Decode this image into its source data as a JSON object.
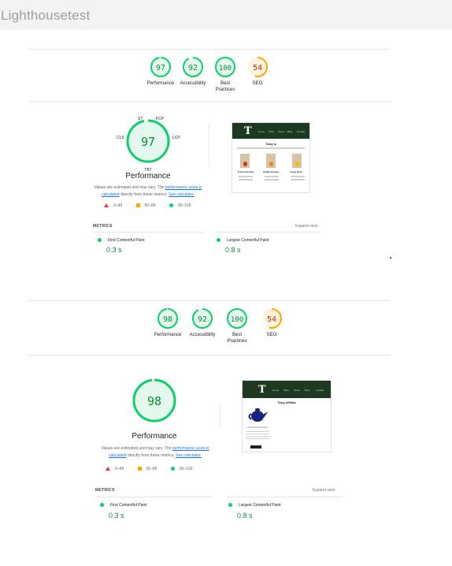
{
  "header": {
    "title": "Lighthousetest"
  },
  "report1": {
    "gauges": [
      {
        "score": "97",
        "label1": "Performance",
        "label2": "",
        "fraction": 0.97,
        "color": "#0cce6b",
        "bg": "#e5f8ee",
        "text": "#0c8a3a"
      },
      {
        "score": "92",
        "label1": "Accessibility",
        "label2": "",
        "fraction": 0.92,
        "color": "#0cce6b",
        "bg": "#e5f8ee",
        "text": "#0c8a3a"
      },
      {
        "score": "100",
        "label1": "Best",
        "label2": "Practices",
        "fraction": 1.0,
        "color": "#0cce6b",
        "bg": "#e5f8ee",
        "text": "#0c8a3a"
      },
      {
        "score": "54",
        "label1": "SEO",
        "label2": "",
        "fraction": 0.54,
        "color": "#ffa400",
        "bg": "#fff3e0",
        "text": "#c33300"
      }
    ],
    "big_score": "97",
    "big_label": "Performance",
    "metric_labels": {
      "st": "ST",
      "fcp": "FCP",
      "cls": "CLS",
      "lcp": "LCP",
      "tbt": "TBT"
    },
    "desc_a": "Values are estimated and may vary. The ",
    "desc_link1": "performance score is calculated",
    "desc_b": " directly from these metrics. ",
    "desc_link2": "See calculator.",
    "legend": [
      "0–49",
      "50–89",
      "90–100"
    ],
    "metrics_title": "METRICS",
    "expand": "Expand view",
    "metrics": [
      {
        "name": "First Contentful Paint",
        "value": "0.3 s"
      },
      {
        "name": "Largest Contentful Paint",
        "value": "0.8 s"
      }
    ],
    "shot": {
      "logo": "T",
      "heading": "Teasy la",
      "nav": [
        "Home",
        "Shop",
        "About",
        "Blog",
        "Contact"
      ],
      "products": [
        "Formosa Oolong",
        "Golden Jasmine",
        "Honey Bush"
      ]
    }
  },
  "report2": {
    "gauges": [
      {
        "score": "98",
        "label1": "Performance",
        "label2": "",
        "fraction": 0.98,
        "color": "#0cce6b",
        "bg": "#e5f8ee",
        "text": "#0c8a3a"
      },
      {
        "score": "92",
        "label1": "Accessibility",
        "label2": "",
        "fraction": 0.92,
        "color": "#0cce6b",
        "bg": "#e5f8ee",
        "text": "#0c8a3a"
      },
      {
        "score": "100",
        "label1": "Best",
        "label2": "Practices",
        "fraction": 1.0,
        "color": "#0cce6b",
        "bg": "#e5f8ee",
        "text": "#0c8a3a"
      },
      {
        "score": "54",
        "label1": "SEO",
        "label2": "",
        "fraction": 0.54,
        "color": "#ffa400",
        "bg": "#fff3e0",
        "text": "#c33300"
      }
    ],
    "big_score": "98",
    "big_label": "Performance",
    "desc_a": "Values are estimated and may vary. The ",
    "desc_link1": "performance score is calculated",
    "desc_b": " directly from these metrics. ",
    "desc_link2": "See calculator.",
    "legend": [
      "0–49",
      "50–89",
      "90–100"
    ],
    "metrics_title": "METRICS",
    "expand": "Expand view",
    "metrics": [
      {
        "name": "First Contentful Paint",
        "value": "0.3 s"
      },
      {
        "name": "Largest Contentful Paint",
        "value": "0.8 s"
      }
    ],
    "shot": {
      "logo": "T",
      "heading": "Teasy Affiliate",
      "nav": [
        "Home",
        "Shop",
        "About",
        "Blog",
        "Contact"
      ]
    }
  }
}
